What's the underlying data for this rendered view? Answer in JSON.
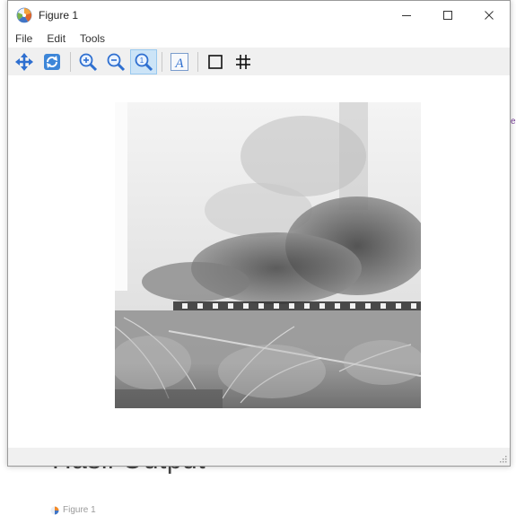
{
  "window": {
    "title": "Figure 1"
  },
  "menu": {
    "items": [
      "File",
      "Edit",
      "Tools"
    ]
  },
  "toolbar": {
    "buttons": [
      {
        "name": "pan",
        "icon": "pan-arrows-icon"
      },
      {
        "name": "reset",
        "icon": "refresh-icon"
      },
      {
        "name": "zoom-in",
        "icon": "zoom-in-icon"
      },
      {
        "name": "zoom-out",
        "icon": "zoom-out-icon"
      },
      {
        "name": "zoom-rect",
        "icon": "zoom-rect-icon",
        "active": true
      },
      {
        "name": "text",
        "icon": "text-icon"
      },
      {
        "name": "box",
        "icon": "square-icon"
      },
      {
        "name": "grid",
        "icon": "grid-icon"
      }
    ],
    "accent": "#2e6fd0"
  },
  "background_page": {
    "heading": "Hasil Output",
    "figure_label": "Figure 1"
  },
  "image": {
    "description_type": "grayscale double-exposure photograph"
  }
}
